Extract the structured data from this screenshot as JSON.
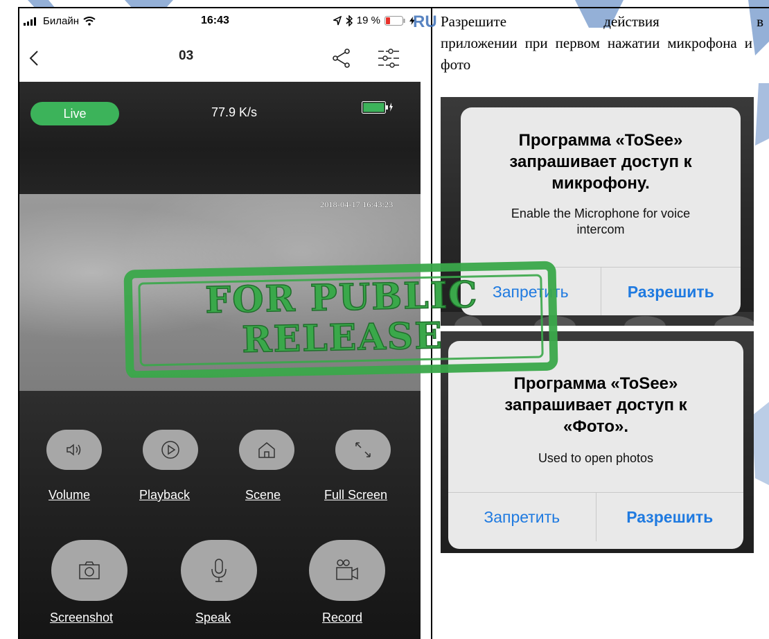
{
  "phone": {
    "status": {
      "carrier": "Билайн",
      "time": "16:43",
      "battery_percent": "19 %"
    },
    "nav": {
      "title": "03"
    },
    "stream": {
      "live_label": "Live",
      "speed": "77.9 K/s",
      "battery_level": 1.0,
      "timestamp": "2018-04-17 16:43:23"
    },
    "controls_row1": [
      {
        "label": "Volume",
        "icon": "speaker-icon"
      },
      {
        "label": "Playback",
        "icon": "play-icon"
      },
      {
        "label": "Scene",
        "icon": "home-icon"
      },
      {
        "label": "Full Screen",
        "icon": "expand-icon"
      }
    ],
    "controls_row2": [
      {
        "label": "Screenshot",
        "icon": "camera-icon"
      },
      {
        "label": "Speak",
        "icon": "microphone-icon"
      },
      {
        "label": "Record",
        "icon": "video-camera-icon"
      }
    ]
  },
  "doc": {
    "paragraph_words_line1": [
      "Разрешите",
      "действия",
      "в"
    ],
    "paragraph_rest": "приложении при первом нажатии микрофона и фото"
  },
  "dialog_mic": {
    "title": "Программа «ToSee» запрашивает доступ к микрофону.",
    "message": "Enable the Microphone for voice intercom",
    "deny": "Запретить",
    "allow": "Разрешить"
  },
  "dialog_photo": {
    "title": "Программа «ToSee» запрашивает доступ к «Фото».",
    "message": "Used to open photos",
    "deny": "Запретить",
    "allow": "Разрешить"
  },
  "watermark": {
    "stamp_line1": "FOR PUBLIC",
    "stamp_line2": "RELEASE",
    "ru_mark": "RU"
  },
  "colors": {
    "live_green": "#3cb35a",
    "ios_blue": "#1f7ae0",
    "stamp_green": "#3aa84a"
  }
}
